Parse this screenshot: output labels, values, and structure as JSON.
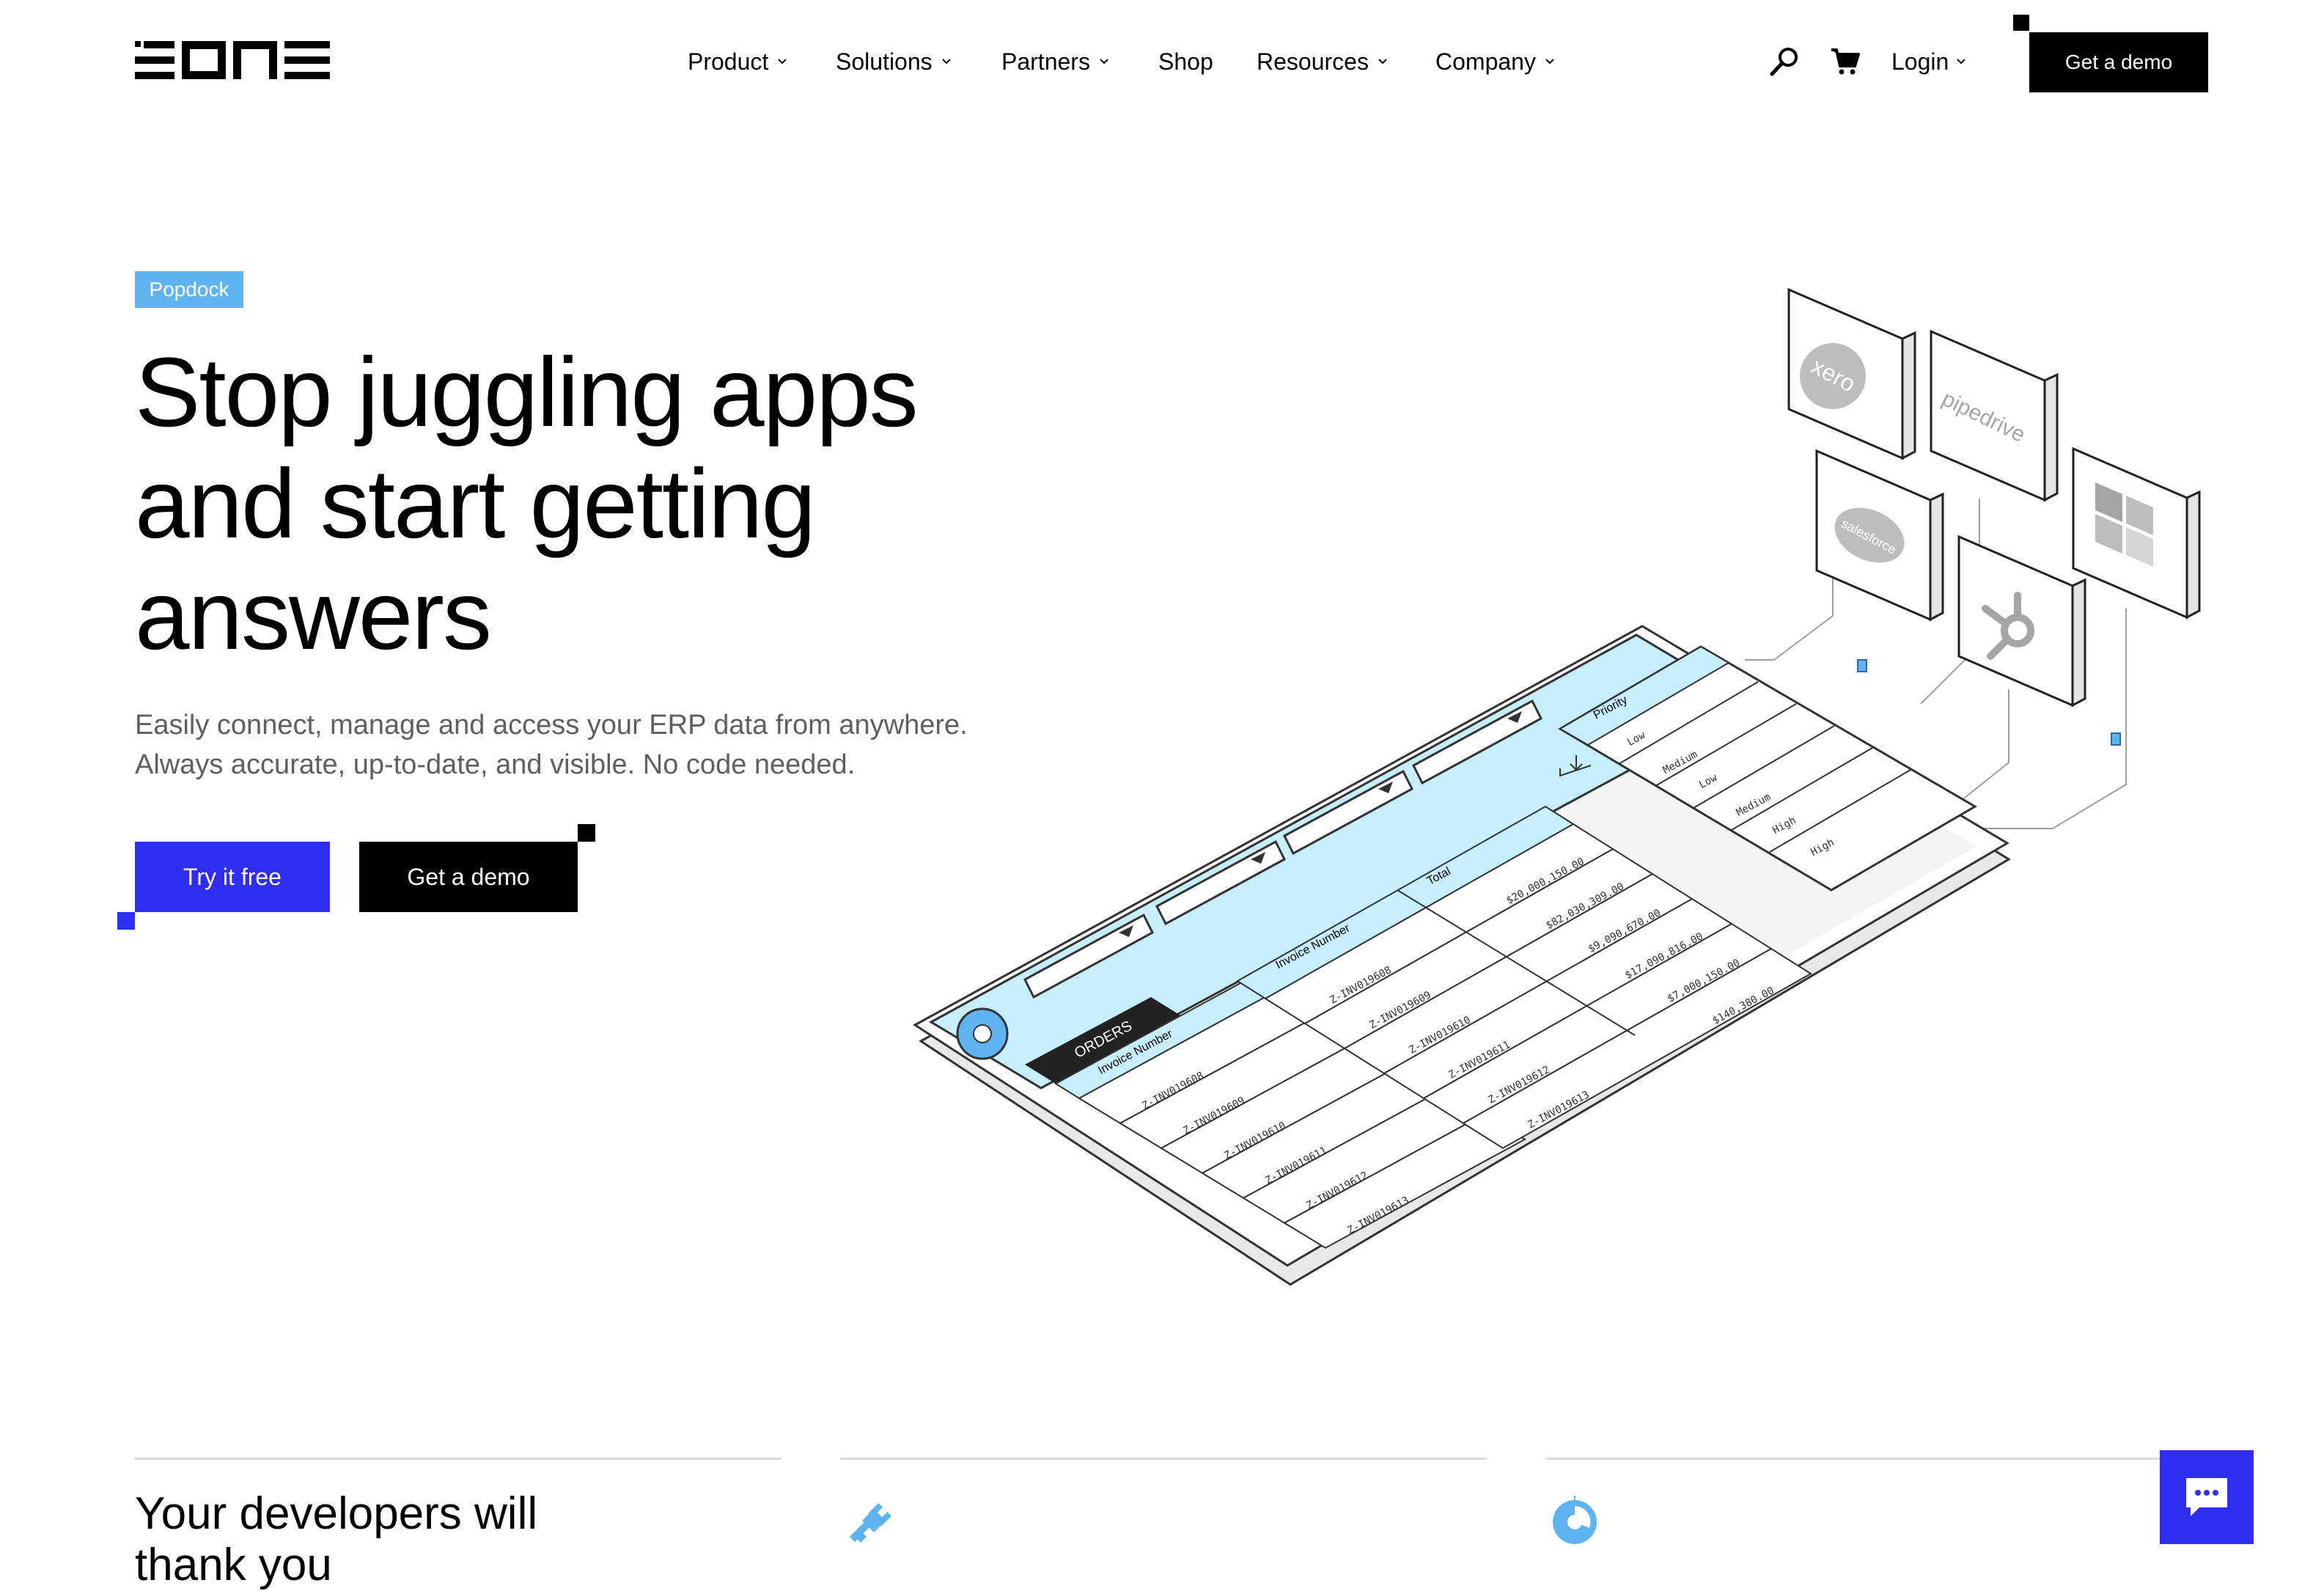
{
  "brand": {
    "logo_text": "EONE",
    "accent": "#2f2ef0",
    "tag_color": "#5fb4f0",
    "illustration_cyan": "#c7eefc"
  },
  "nav": {
    "items": [
      {
        "label": "Product",
        "has_dropdown": true
      },
      {
        "label": "Solutions",
        "has_dropdown": true
      },
      {
        "label": "Partners",
        "has_dropdown": true
      },
      {
        "label": "Shop",
        "has_dropdown": false
      },
      {
        "label": "Resources",
        "has_dropdown": true
      },
      {
        "label": "Company",
        "has_dropdown": true
      }
    ],
    "login_label": "Login",
    "cta_label": "Get a demo",
    "icons": [
      "search-icon",
      "cart-icon",
      "chevron-down-icon"
    ]
  },
  "hero": {
    "tag": "Popdock",
    "headline_lines": [
      "Stop juggling apps",
      "and start getting",
      "answers"
    ],
    "sub_lines": [
      "Easily connect, manage and access your ERP data from anywhere.",
      "Always accurate, up-to-date, and visible. No code needed."
    ],
    "primary_cta": "Try it free",
    "secondary_cta": "Get a demo"
  },
  "illustration": {
    "integrations": [
      "xero",
      "pipedrive",
      "salesforce",
      "hubspot-icon",
      "windows-icon"
    ],
    "table_tab": "ORDERS",
    "left_header": "Invoice Number",
    "center_headers": [
      "Invoice Number",
      "Total"
    ],
    "side_header": "Priority",
    "left_rows": [
      "Z-INV019608",
      "Z-INV019609",
      "Z-INV019610",
      "Z-INV019611",
      "Z-INV019612",
      "Z-INV019613"
    ],
    "center_invoice": [
      "Z-INV019608",
      "Z-INV019609",
      "Z-INV019610",
      "Z-INV019611",
      "Z-INV019612",
      "Z-INV019613"
    ],
    "center_totals": [
      "$20,000,150.00",
      "$82,030,309.00",
      "$9,090,670.00",
      "$17,090,816.00",
      "$7,000,150.00",
      "$140,380.00"
    ],
    "priority": [
      "Low",
      "Medium",
      "Low",
      "Medium",
      "High",
      "High"
    ]
  },
  "cards": {
    "first_title_lines": [
      "Your developers will",
      "thank you"
    ],
    "icons": [
      "plug-icon",
      "pie-chart-icon"
    ]
  },
  "chat": {
    "icon": "chat-icon"
  }
}
